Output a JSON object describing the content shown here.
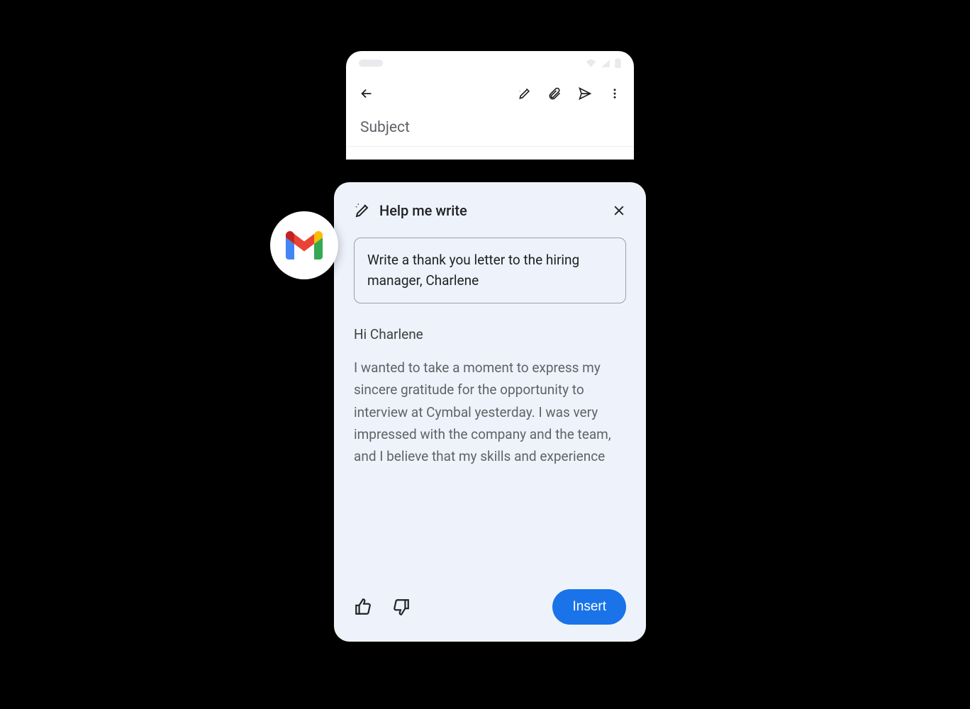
{
  "compose": {
    "subject_placeholder": "Subject"
  },
  "hmw": {
    "title": "Help me write",
    "prompt": "Write a thank you letter to the hiring manager, Charlene",
    "greeting": "Hi Charlene",
    "body": "I wanted to take a moment to express my sincere gratitude for the opportunity to interview at Cymbal yesterday. I was very impressed with the company and the team, and I believe that my skills and experience",
    "insert_label": "Insert"
  },
  "icons": {
    "back": "back-icon",
    "magic": "magic-pencil-icon",
    "attach": "attachment-icon",
    "send": "send-icon",
    "more": "more-vert-icon",
    "close": "close-icon",
    "thumbs_up": "thumbs-up-icon",
    "thumbs_down": "thumbs-down-icon",
    "gmail": "gmail-icon"
  }
}
